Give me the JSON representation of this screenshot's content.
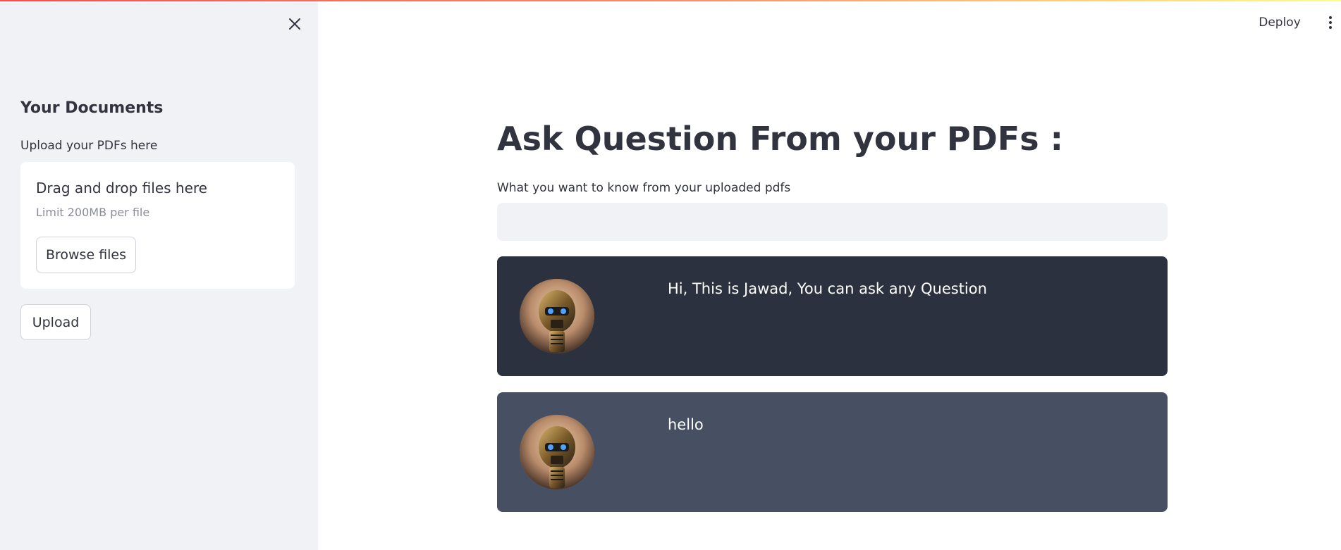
{
  "sidebar": {
    "heading": "Your Documents",
    "uploader_label": "Upload your PDFs here",
    "dropzone": {
      "title": "Drag and drop files here",
      "limit": "Limit 200MB per file",
      "browse_label": "Browse files"
    },
    "upload_label": "Upload"
  },
  "header": {
    "deploy_label": "Deploy"
  },
  "main": {
    "title": "Ask Question From your PDFs :",
    "question_label": "What you want to know from your uploaded pdfs",
    "question_value": "",
    "messages": [
      {
        "text": "Hi, This is Jawad, You can ask any Question",
        "background": "#2b313e"
      },
      {
        "text": "hello",
        "background": "#475063"
      }
    ]
  },
  "colors": {
    "sidebar_bg": "#F0F2F6",
    "text": "#31333F",
    "bot_message_bg": "#2b313e",
    "user_message_bg": "#475063"
  },
  "icons": {
    "close": "close-icon",
    "menu": "kebab-menu-icon",
    "avatar": "robot-avatar"
  }
}
